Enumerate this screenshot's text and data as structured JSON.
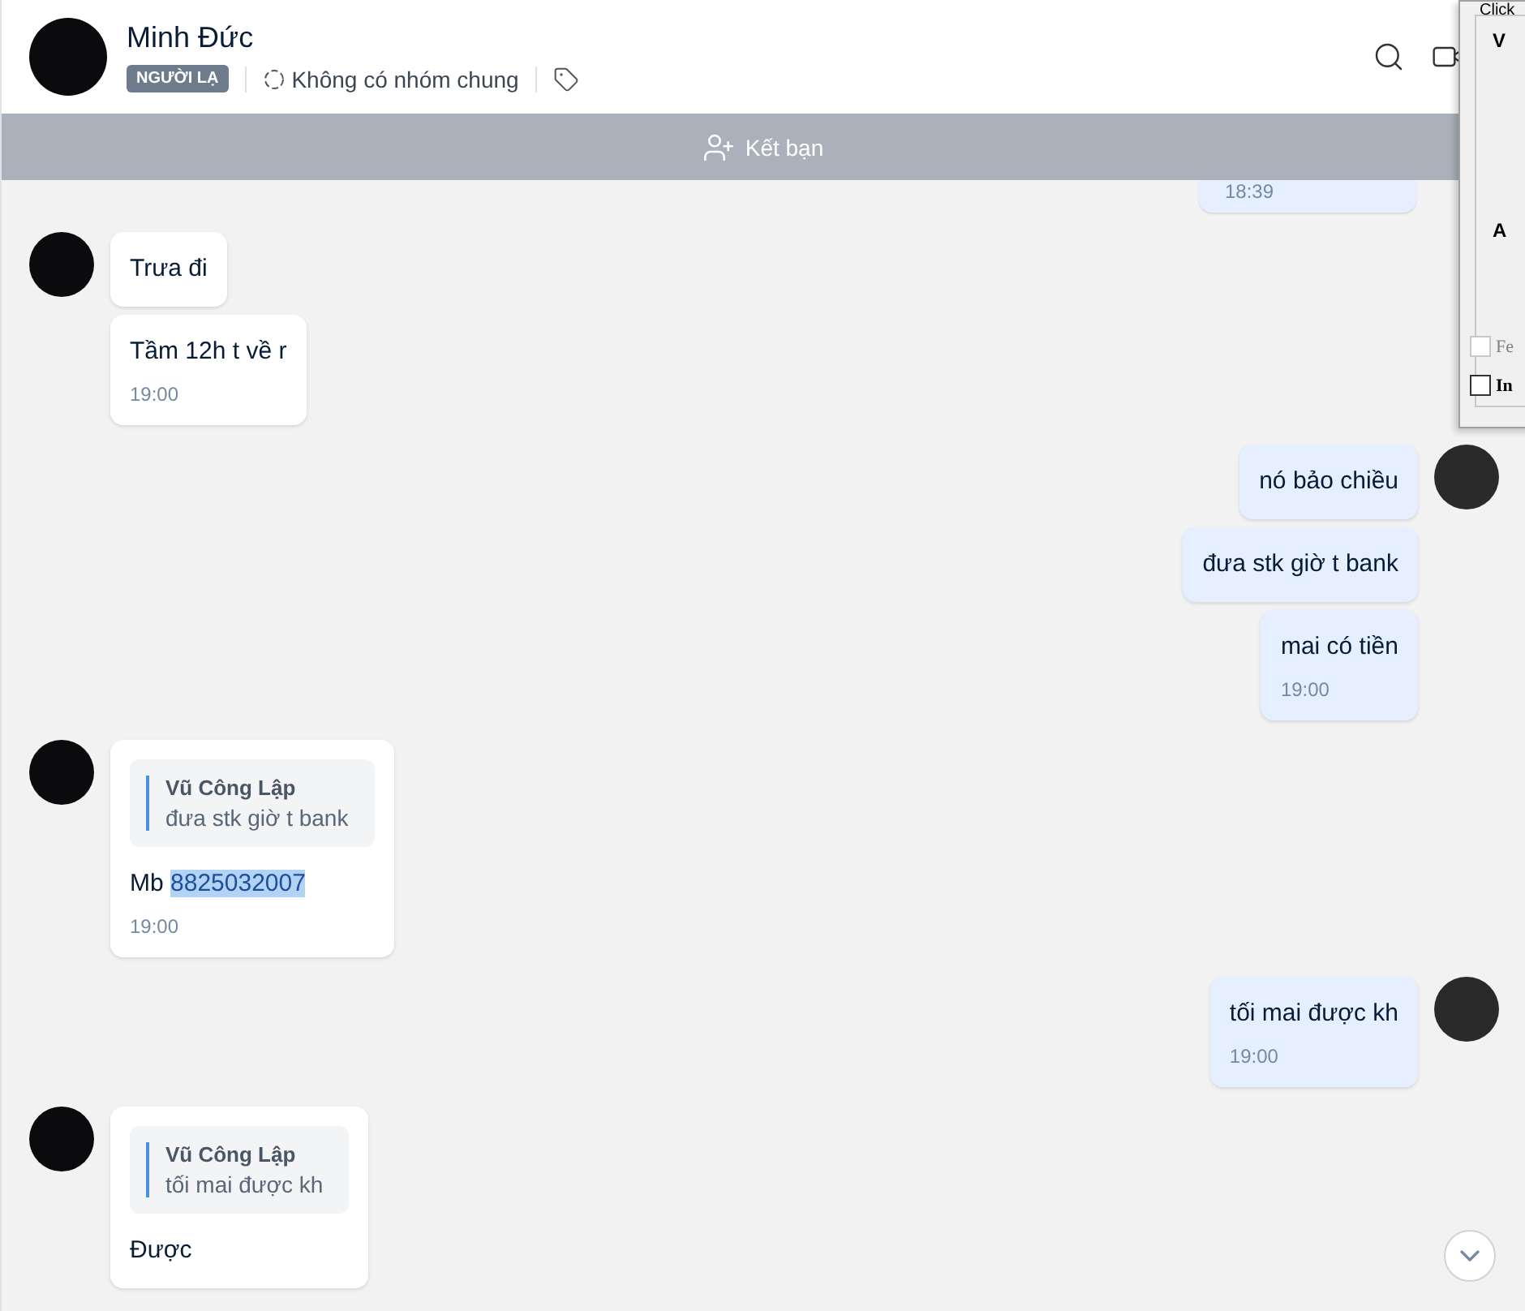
{
  "header": {
    "name": "Minh Đức",
    "badge": "NGƯỜI LẠ",
    "groups": "Không có nhóm chung"
  },
  "banner": {
    "label": "Kết bạn"
  },
  "messages": {
    "cut_time": "18:39",
    "groups": [
      {
        "kind": "incoming",
        "items": [
          {
            "text": "Trưa đi"
          },
          {
            "text": "Tầm 12h t về r",
            "time": "19:00"
          }
        ]
      },
      {
        "kind": "outgoing",
        "items": [
          {
            "text": "nó bảo chiều"
          },
          {
            "text": "đưa stk giờ t bank"
          },
          {
            "text": "mai có tiền",
            "time": "19:00"
          }
        ]
      },
      {
        "kind": "incoming",
        "items": [
          {
            "quote": {
              "author": "Vũ Công Lập",
              "text": "đưa stk giờ t bank"
            },
            "text": "Mb ",
            "highlighted": "8825032007",
            "time": "19:00"
          }
        ]
      },
      {
        "kind": "outgoing",
        "items": [
          {
            "text": "tối mai được kh",
            "time": "19:00"
          }
        ]
      },
      {
        "kind": "incoming",
        "items": [
          {
            "quote": {
              "author": "Vũ Công Lập",
              "text": "tối mai được kh"
            },
            "text": "Được"
          }
        ]
      }
    ]
  },
  "dialog": {
    "caption": "Click",
    "heading_1": "V",
    "heading_2": "A",
    "checkboxes": [
      {
        "label": "Fe",
        "checked": false,
        "disabled": true
      },
      {
        "label": "In",
        "checked": false,
        "disabled": false
      }
    ]
  }
}
